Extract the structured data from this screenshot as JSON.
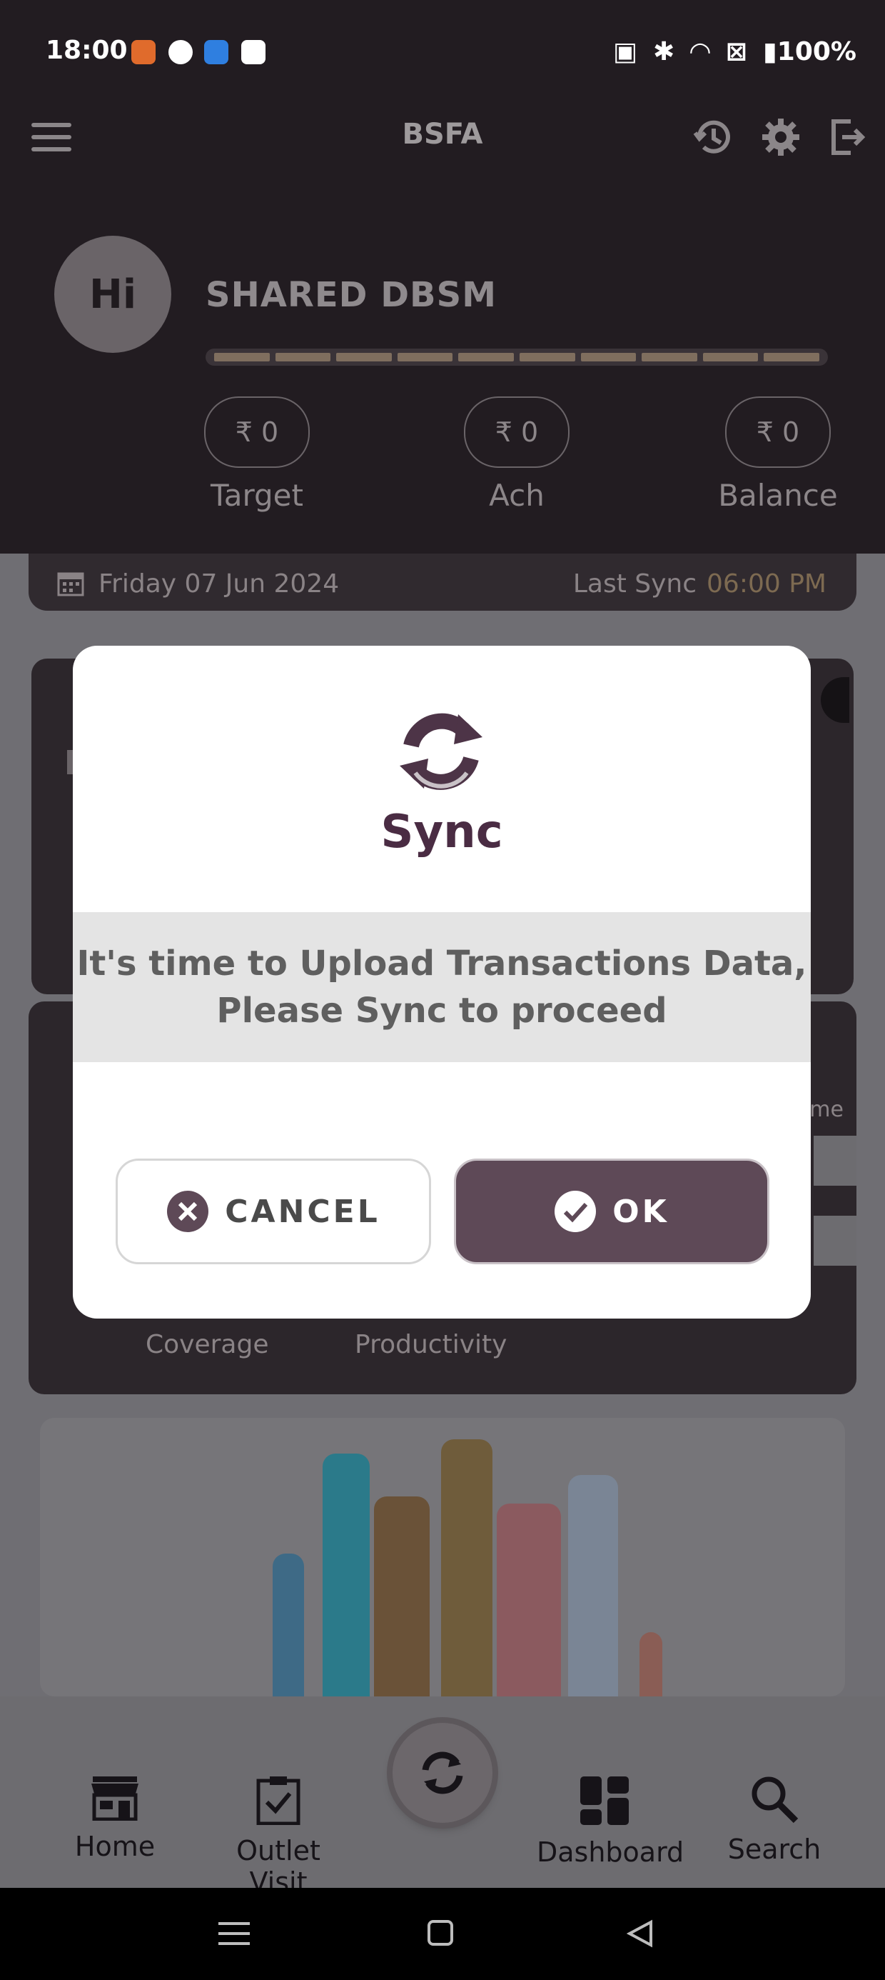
{
  "status_bar": {
    "time": "18:00",
    "battery": "100%"
  },
  "header": {
    "title": "BSFA"
  },
  "profile": {
    "avatar_text": "Hi",
    "name": "SHARED DBSM"
  },
  "kpis": [
    {
      "value": "₹ 0",
      "label": "Target"
    },
    {
      "value": "₹ 0",
      "label": "Ach"
    },
    {
      "value": "₹ 0",
      "label": "Balance"
    }
  ],
  "date_bar": {
    "date": "Friday 07 Jun 2024",
    "last_sync_label": "Last Sync",
    "last_sync_time": "06:00 PM"
  },
  "background": {
    "tab_coverage": "Coverage",
    "tab_productivity": "Productivity",
    "partial_text": "ame"
  },
  "dialog": {
    "title": "Sync",
    "message_line1": "It's time to Upload Transactions Data,",
    "message_line2": "Please Sync to proceed",
    "cancel_label": "CANCEL",
    "ok_label": "OK"
  },
  "bottom_nav": {
    "home": "Home",
    "outlet_visit": "Outlet Visit",
    "dashboard": "Dashboard",
    "search": "Search"
  },
  "colors": {
    "accent": "#5e4957",
    "header_bg": "#221c21",
    "dialog_title": "#4a2c43"
  },
  "icons": [
    "menu-icon",
    "history-icon",
    "settings-icon",
    "logout-icon",
    "calendar-icon",
    "sync-icon",
    "close-circle-icon",
    "check-circle-icon",
    "store-icon",
    "clipboard-check-icon",
    "dashboard-grid-icon",
    "search-icon"
  ]
}
